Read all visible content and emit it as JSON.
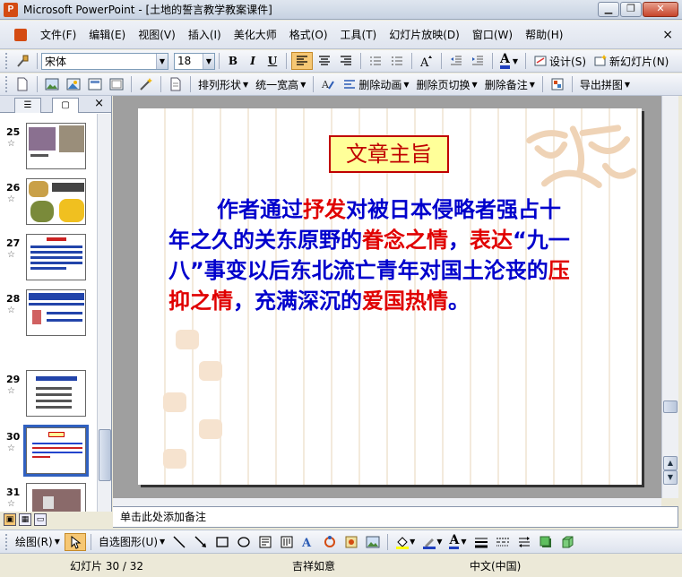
{
  "window": {
    "title": "Microsoft PowerPoint - [土地的誓言教学教案课件]",
    "app_icon": "powerpoint-icon",
    "buttons": [
      "minimize",
      "restore",
      "close"
    ]
  },
  "menu": {
    "items": [
      "文件(F)",
      "编辑(E)",
      "视图(V)",
      "插入(I)",
      "美化大师",
      "格式(O)",
      "工具(T)",
      "幻灯片放映(D)",
      "窗口(W)",
      "帮助(H)"
    ],
    "close_glyph": "×"
  },
  "format_toolbar": {
    "font_name": "宋体",
    "font_size": "18",
    "bold": "B",
    "italic": "I",
    "underline": "U",
    "font_color_label": "A",
    "design_label": "设计(S)",
    "new_slide_label": "新幻灯片(N)"
  },
  "beautify_toolbar": {
    "arrange_label": "排列形状",
    "uniform_width_label": "统一宽高",
    "delete_animation_label": "删除动画",
    "delete_transition_label": "删除页切换",
    "delete_notes_label": "删除备注",
    "export_label": "导出拼图"
  },
  "slides_panel": {
    "thumbnails": [
      {
        "number": "25"
      },
      {
        "number": "26"
      },
      {
        "number": "27"
      },
      {
        "number": "28"
      },
      {
        "number": "29"
      },
      {
        "number": "30",
        "selected": true
      },
      {
        "number": "31"
      }
    ],
    "star_glyph": "☆",
    "close_glyph": "×"
  },
  "slide": {
    "title": "文章主旨",
    "body_segments": [
      {
        "text": "作者通过",
        "color": "blue"
      },
      {
        "text": "抒发",
        "color": "red"
      },
      {
        "text": "对被日本侵略者强占十年之久的关东原野的",
        "color": "blue"
      },
      {
        "text": "眷念之情",
        "color": "red"
      },
      {
        "text": "，",
        "color": "blue"
      },
      {
        "text": "表达",
        "color": "red"
      },
      {
        "text": "“九一八”事变以后东北流亡青年对国土沦丧的",
        "color": "blue"
      },
      {
        "text": "压抑之情",
        "color": "red"
      },
      {
        "text": "，充满深沉的",
        "color": "blue"
      },
      {
        "text": "爱国热情",
        "color": "red"
      },
      {
        "text": "。",
        "color": "blue"
      }
    ]
  },
  "colors": {
    "blue_text": "#0000cc",
    "red_text": "#e00000",
    "title_fill": "#ffff99",
    "title_border": "#c00000"
  },
  "notes": {
    "placeholder": "单击此处添加备注"
  },
  "draw_toolbar": {
    "draw_label": "绘图(R)",
    "autoshapes_label": "自选图形(U)"
  },
  "status": {
    "slide_label": "幻灯片 30 / 32",
    "design_name": "吉祥如意",
    "language": "中文(中国)"
  }
}
